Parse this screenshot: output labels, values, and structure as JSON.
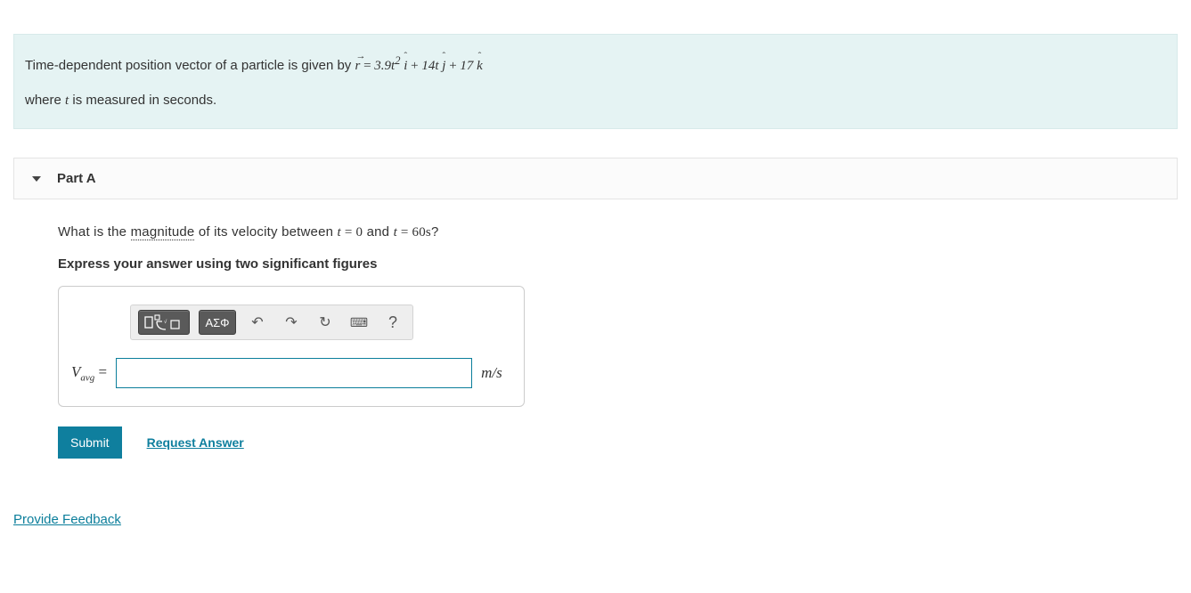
{
  "problem": {
    "line1_prefix": "Time-dependent position vector of a particle is given by ",
    "coeff_i": "3.9",
    "exp_i": "2",
    "coeff_j": "14",
    "const_k": "17",
    "line2": "where ",
    "line2_var": "t",
    "line2_suffix": " is measured in seconds."
  },
  "part": {
    "title": "Part A",
    "question_prefix": "What is the ",
    "question_underlined": "magnitude",
    "question_mid": " of its velocity between ",
    "t0_lhs": "t",
    "t0_rhs": "0",
    "and": " and ",
    "t1_lhs": "t",
    "t1_rhs": "60s",
    "question_suffix": "?",
    "instruction": "Express your answer using two significant figures",
    "var_lhs": "V",
    "var_sub": "avg",
    "equals": " =",
    "units": "m/s",
    "input_value": ""
  },
  "toolbar": {
    "templates_label": "templates-icon",
    "symbols_label": "ΑΣΦ",
    "undo": "↶",
    "redo": "↷",
    "reset": "↻",
    "keyboard": "⌨",
    "help": "?"
  },
  "actions": {
    "submit": "Submit",
    "request_answer": "Request Answer"
  },
  "footer": {
    "provide_feedback": "Provide Feedback"
  }
}
